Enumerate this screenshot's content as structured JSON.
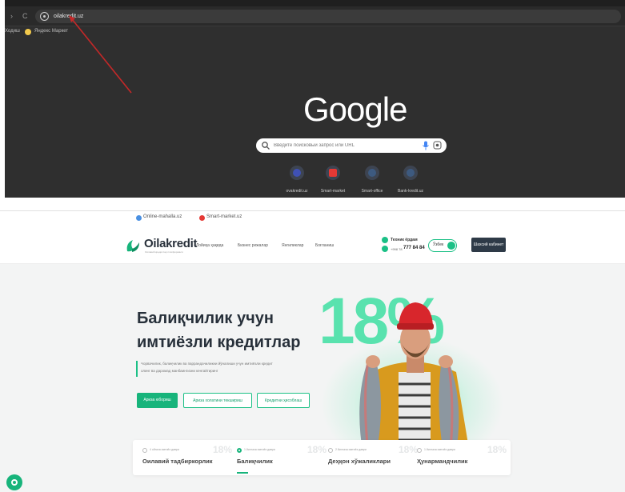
{
  "browser": {
    "nav": {
      "back_glyph": "›",
      "reload_glyph": "C"
    },
    "url": "oilakredit.uz",
    "bookmarks_label": "Ходиш",
    "bookmark_item": "Яндекс Маркет",
    "newtab": {
      "logo": "Google",
      "search_placeholder": "Введите поисковый запрос или URL",
      "shortcuts": [
        {
          "label": "ovakredit.uz",
          "color": "#3f51b5"
        },
        {
          "label": "Smart-market",
          "color": "#e53935"
        },
        {
          "label": "Smart-office",
          "color": "#3d5a80"
        },
        {
          "label": "Bank-kredit.uz",
          "color": "#3d5a80"
        }
      ]
    },
    "annotation_color": "#c62828"
  },
  "site": {
    "bookmarks": [
      {
        "label": "Online-mahalla.uz",
        "color": "#4a90e2"
      },
      {
        "label": "Smart-market.uz",
        "color": "#e53935"
      }
    ],
    "logo": {
      "name": "Oilakredit",
      "tagline": "Оилавий кредитлар платформаси"
    },
    "nav": [
      "Лойиҳа ҳақида",
      "Бизнес режалар",
      "Янгиликлар",
      "Боғланиш"
    ],
    "support": {
      "label": "Техник ёрдам",
      "phone_prefix": "+998 78",
      "phone_main": "777 84 84"
    },
    "language": "Ўзбек",
    "cabinet_button": "Шахсий кабинет",
    "hero": {
      "title_line1": "Балиқчилик учун",
      "title_line2": "имтиёзли кредитлар",
      "subtitle_line1": "Чорвачилик, балиқчилик ва паррандачиликни йўналиши учун имтиёзли кредит",
      "subtitle_line2": "олинг ва даромад манбаингизни кенгайтиринг",
      "big_number": "18%",
      "buttons": [
        "Ариза юбориш",
        "Ариза холатини текшириш",
        "Кредитни ҳисоблаш"
      ]
    },
    "cards": [
      {
        "small": "4 ойгача имтиёз даври",
        "pct": "18%",
        "title": "Оилавий тадбиркорлик",
        "active": false
      },
      {
        "small": "1 йилгача имтиёз даври",
        "pct": "18%",
        "title": "Балиқчилик",
        "active": true
      },
      {
        "small": "2 йилгача имтиёз даври",
        "pct": "18%",
        "title": "Деҳқон хўжаликлари",
        "active": false
      },
      {
        "small": "1 йилгача имтиёз даври",
        "pct": "18%",
        "title": "Ҳунармандчилик",
        "active": false
      }
    ],
    "accent_color": "#17b47b"
  }
}
